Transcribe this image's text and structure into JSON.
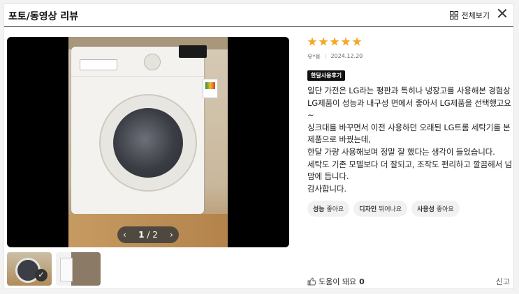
{
  "header": {
    "title": "포토/동영상 리뷰",
    "view_all_label": "전체보기"
  },
  "viewer": {
    "counter_current": "1",
    "counter_sep": "/",
    "counter_total": "2"
  },
  "review": {
    "rating": 5,
    "author": "유*용",
    "date": "2024.12.20",
    "tag": "한달사용후기",
    "body": "일단 가전은 LG라는 평판과 특히나 냉장고를 사용해본 경험상 LG제품이 성능과 내구성 면에서 좋아서 LG제품을 선택했고요~\n싱크대를 바꾸면서 이전 사용하던 오래된 LG트롬 세탁기를 본제품으로 바꿨는데,\n한달 가량 사용해보며 정말 잘 했다는 생각이 들었습니다.\n세탁도 기존 모델보다 더 잘되고, 조작도 편리하고 깔끔해서 넘 맘에 듭니다.\n감사합니다.",
    "chips": [
      {
        "label": "성능",
        "value": "좋아요"
      },
      {
        "label": "디자인",
        "value": "뛰어나요"
      },
      {
        "label": "사용성",
        "value": "좋아요"
      }
    ]
  },
  "footer": {
    "helpful_label": "도움이 돼요",
    "helpful_count": "0",
    "report_label": "신고"
  },
  "colors": {
    "star": "#f5a623",
    "tag_bg": "#111111"
  }
}
